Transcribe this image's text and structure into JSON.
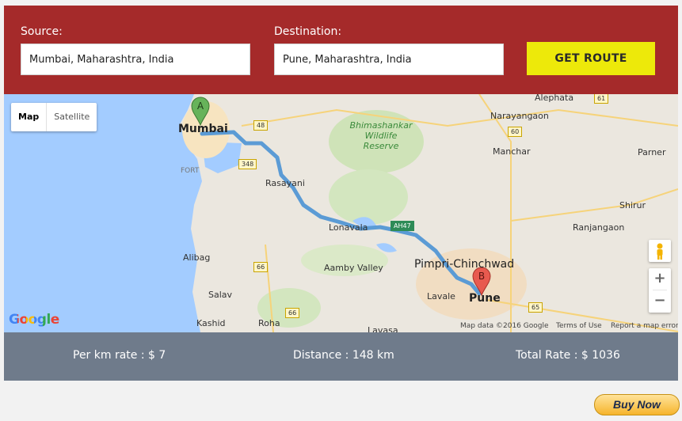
{
  "form": {
    "source_label": "Source:",
    "source_value": "Mumbai, Maharashtra, India",
    "destination_label": "Destination:",
    "destination_value": "Pune, Maharashtra, India",
    "get_route_label": "GET ROUTE"
  },
  "map": {
    "type_controls": {
      "map": "Map",
      "satellite": "Satellite"
    },
    "markers": {
      "start": "A",
      "end": "B"
    },
    "zoom_in": "+",
    "zoom_out": "−",
    "google_logo": "Google",
    "places": {
      "mumbai": "Mumbai",
      "fort": "FORT",
      "rasayani": "Rasayani",
      "alibag": "Alibag",
      "salav": "Salav",
      "kashid": "Kashid",
      "roha": "Roha",
      "lonavala": "Lonavala",
      "aamby_valley": "Aamby Valley",
      "bhimashankar": "Bhimashankar Wildlife Reserve",
      "pimpri": "Pimpri-Chinchwad",
      "lavale": "Lavale",
      "pune": "Pune",
      "alephata": "Alephata",
      "narayangaon": "Narayangaon",
      "manchar": "Manchar",
      "parner": "Parner",
      "shirur": "Shirur",
      "ranjangaon": "Ranjangaon",
      "lavasa": "Lavasa"
    },
    "highway_shields": {
      "h48": "48",
      "h348": "348",
      "h66a": "66",
      "h66b": "66",
      "h60": "60",
      "h61": "61",
      "h65": "65",
      "ah47": "AH47"
    },
    "attribution": {
      "data": "Map data ©2016 Google",
      "terms": "Terms of Use",
      "report": "Report a map error"
    }
  },
  "summary": {
    "per_km": "Per km rate : $ 7",
    "distance": "Distance : 148 km",
    "total": "Total Rate : $ 1036"
  },
  "buy_now_label": "Buy Now",
  "colors": {
    "form_bg": "#a52a2a",
    "button_bg": "#ede90a",
    "summary_bg": "#6f7b8b",
    "route": "#5b9bd5",
    "water": "#a3ccff"
  }
}
